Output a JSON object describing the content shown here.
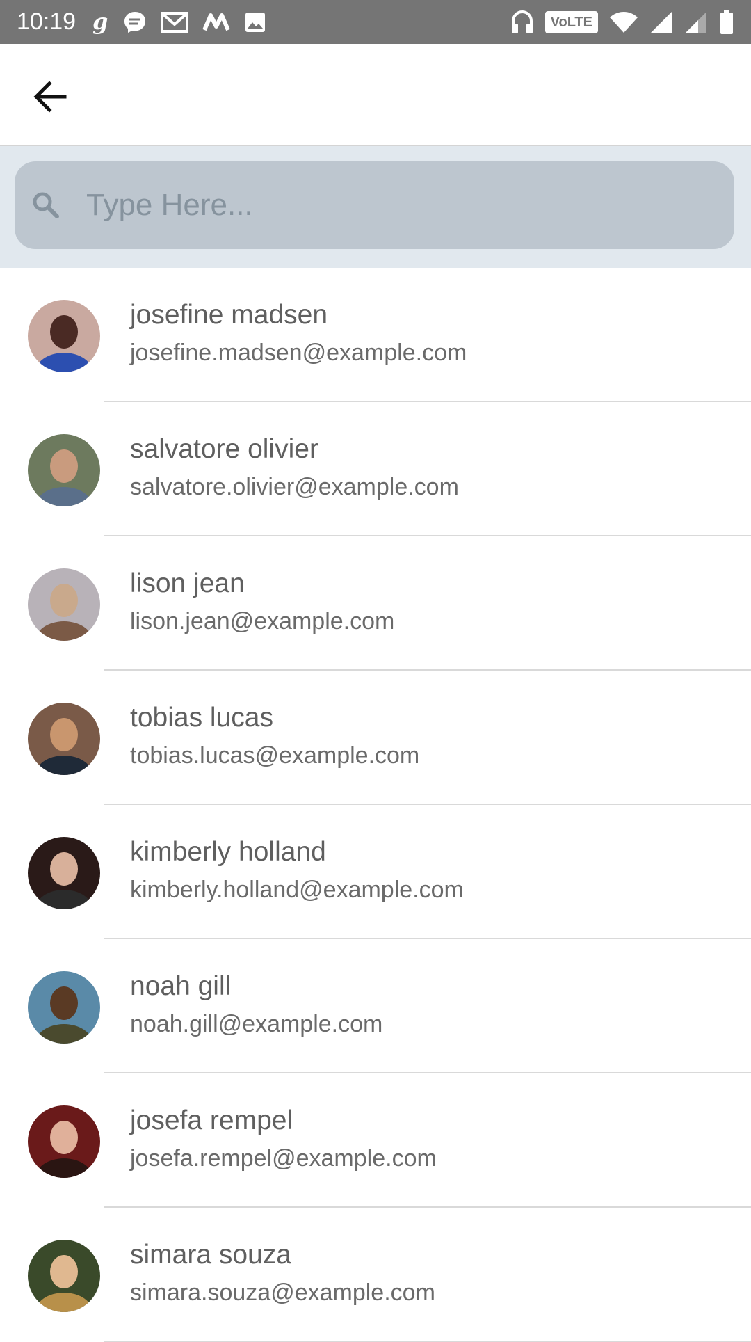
{
  "status_bar": {
    "time": "10:19",
    "left_icons": [
      "g-app-icon",
      "messenger-icon",
      "gmail-icon",
      "m-app-icon",
      "image-icon"
    ],
    "volte_label": "VoLTE",
    "right_icons": [
      "headphones-icon",
      "volte-icon",
      "wifi-icon",
      "signal-icon",
      "signal-icon",
      "battery-icon"
    ]
  },
  "app_bar": {
    "back_icon": "arrow-left-icon"
  },
  "search": {
    "placeholder": "Type Here...",
    "value": "",
    "icon": "search-icon"
  },
  "contacts": [
    {
      "name": "josefine madsen",
      "email": "josefine.madsen@example.com",
      "avatar_colors": [
        "#c9a9a0",
        "#4a2a24",
        "#2c4fb0"
      ]
    },
    {
      "name": "salvatore olivier",
      "email": "salvatore.olivier@example.com",
      "avatar_colors": [
        "#6d7a5e",
        "#c99b7e",
        "#5a6f8a"
      ]
    },
    {
      "name": "lison jean",
      "email": "lison.jean@example.com",
      "avatar_colors": [
        "#b8b2b8",
        "#c9a98c",
        "#7b5a46"
      ]
    },
    {
      "name": "tobias lucas",
      "email": "tobias.lucas@example.com",
      "avatar_colors": [
        "#7a5a48",
        "#c9966e",
        "#1f2a38"
      ]
    },
    {
      "name": "kimberly holland",
      "email": "kimberly.holland@example.com",
      "avatar_colors": [
        "#2a1a18",
        "#d8b09a",
        "#2b2b2b"
      ]
    },
    {
      "name": "noah gill",
      "email": "noah.gill@example.com",
      "avatar_colors": [
        "#5a8aa8",
        "#5a3a24",
        "#4a4a2e"
      ]
    },
    {
      "name": "josefa rempel",
      "email": "josefa.rempel@example.com",
      "avatar_colors": [
        "#6a1a1a",
        "#e0b09a",
        "#2a1512"
      ]
    },
    {
      "name": "simara souza",
      "email": "simara.souza@example.com",
      "avatar_colors": [
        "#3a4a2a",
        "#e0b890",
        "#b8904a"
      ]
    }
  ],
  "colors": {
    "status_bar": "#757575",
    "search_band": "#e1e8ee",
    "search_box": "#bdc6cf",
    "placeholder": "#86939e",
    "divider": "#d9d9d9"
  }
}
